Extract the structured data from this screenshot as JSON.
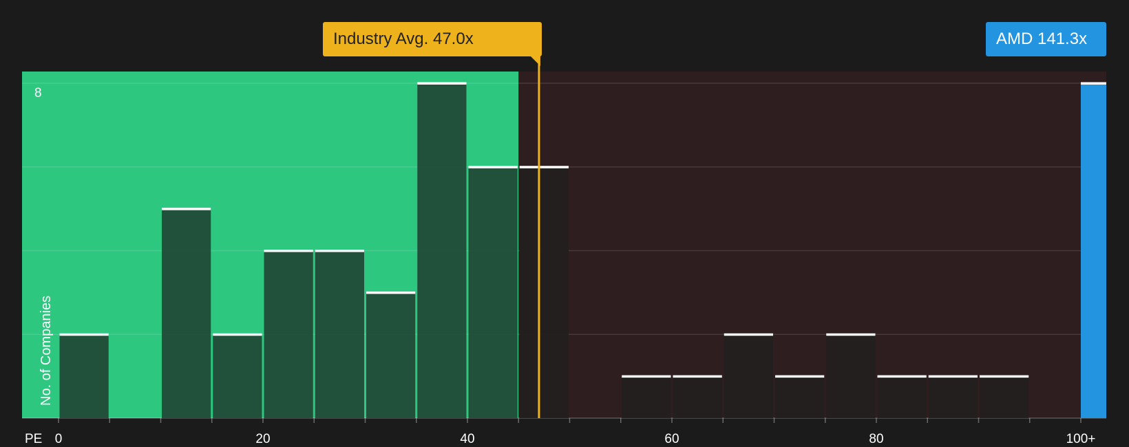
{
  "chart_data": {
    "type": "bar",
    "xlabel": "PE",
    "ylabel": "No. of Companies",
    "bin_width": 5,
    "bins_start": [
      0,
      5,
      10,
      15,
      20,
      25,
      30,
      35,
      40,
      45,
      50,
      55,
      60,
      65,
      70,
      75,
      80,
      85,
      90,
      95
    ],
    "values": [
      2,
      0,
      5,
      2,
      4,
      4,
      3,
      8,
      6,
      6,
      0,
      1,
      1,
      2,
      1,
      2,
      1,
      1,
      1,
      0
    ],
    "overflow_bin": {
      "label": "100+",
      "value": 8
    },
    "x_ticks": [
      "0",
      "20",
      "40",
      "60",
      "80",
      "100+"
    ],
    "y_max": 8,
    "y_max_label": "8",
    "industry_avg": {
      "label": "Industry Avg.",
      "value": 47.0,
      "display": "47.0x"
    },
    "company": {
      "ticker": "AMD",
      "value": 141.3,
      "display": "141.3x"
    },
    "undervalued_limit": 45,
    "colors": {
      "green_zone": "#2ec780",
      "red_zone": "#2f1e1f",
      "industry": "#eeb31c",
      "company": "#2394e0",
      "bar_green": "#214d38",
      "bar_dark": "#241f1f",
      "cap": "#ffffff"
    }
  }
}
